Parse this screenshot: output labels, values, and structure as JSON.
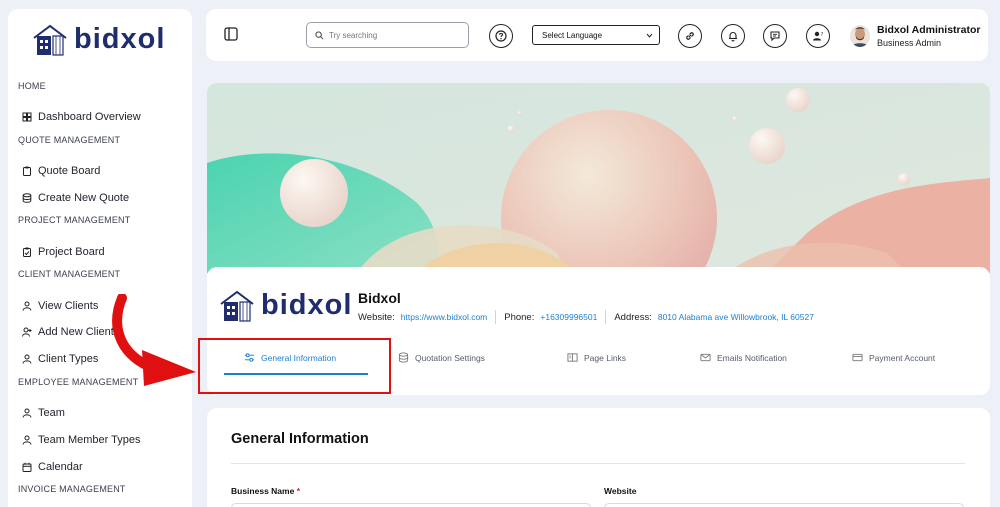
{
  "brand": {
    "name": "bidxol"
  },
  "sidebar": {
    "sections": [
      {
        "title": "HOME",
        "items": [
          {
            "label": "Dashboard Overview",
            "icon": "dashboard-icon"
          }
        ]
      },
      {
        "title": "QUOTE MANAGEMENT",
        "items": [
          {
            "label": "Quote Board",
            "icon": "clipboard-icon"
          },
          {
            "label": "Create New Quote",
            "icon": "database-icon"
          }
        ]
      },
      {
        "title": "PROJECT MANAGEMENT",
        "items": [
          {
            "label": "Project Board",
            "icon": "clipboard-check-icon"
          }
        ]
      },
      {
        "title": "CLIENT MANAGEMENT",
        "items": [
          {
            "label": "View Clients",
            "icon": "user-icon"
          },
          {
            "label": "Add New Client",
            "icon": "user-plus-icon"
          },
          {
            "label": "Client Types",
            "icon": "user-icon"
          }
        ]
      },
      {
        "title": "EMPLOYEE MANAGEMENT",
        "items": [
          {
            "label": "Team",
            "icon": "user-icon"
          },
          {
            "label": "Team Member Types",
            "icon": "user-icon"
          },
          {
            "label": "Calendar",
            "icon": "calendar-icon"
          }
        ]
      },
      {
        "title": "INVOICE MANAGEMENT",
        "items": []
      }
    ]
  },
  "header": {
    "search_placeholder": "Try searching",
    "language_label": "Select Language",
    "user_name": "Bidxol Administrator",
    "user_role": "Business Admin"
  },
  "profile": {
    "name": "Bidxol",
    "website_label": "Website:",
    "website": "https://www.bidxol.com",
    "phone_label": "Phone:",
    "phone": "+16309996501",
    "address_label": "Address:",
    "address": "8010 Alabama ave Willowbrook, IL 60527"
  },
  "tabs": [
    {
      "label": "General Information",
      "icon": "sliders-icon",
      "active": true
    },
    {
      "label": "Quotation Settings",
      "icon": "database-icon",
      "active": false
    },
    {
      "label": "Page Links",
      "icon": "columns-icon",
      "active": false
    },
    {
      "label": "Emails Notification",
      "icon": "mail-icon",
      "active": false
    },
    {
      "label": "Payment Account",
      "icon": "card-icon",
      "active": false
    }
  ],
  "general": {
    "title": "General Information",
    "business_name_label": "Business Name",
    "required_mark": "*",
    "website_label": "Website"
  },
  "colors": {
    "brand": "#1f2d6e",
    "accent": "#1e7fd1",
    "annotation": "#e01010"
  }
}
